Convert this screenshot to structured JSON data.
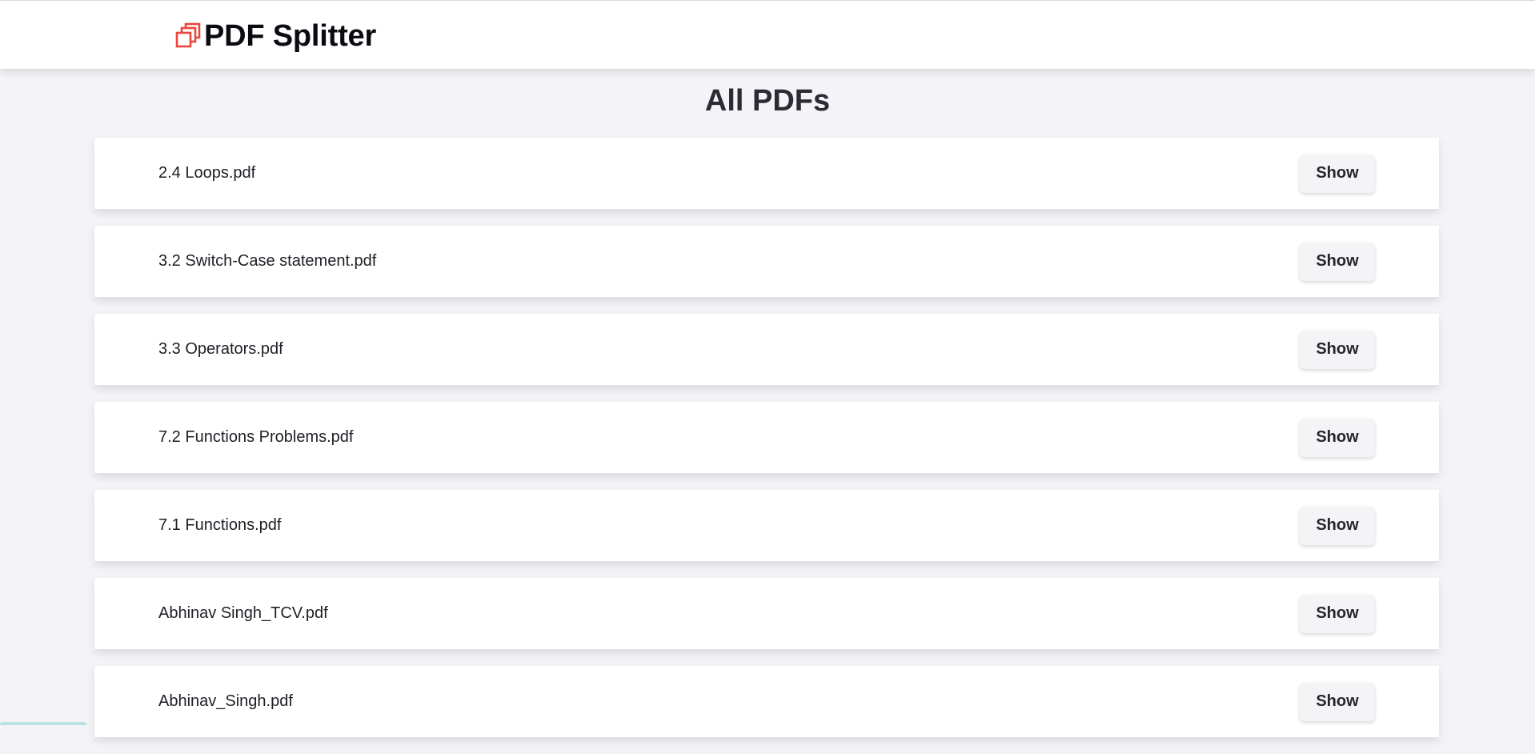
{
  "app": {
    "title": "PDF Splitter",
    "logo_icon": "copy-pages-icon",
    "accent_color": "#e8473e"
  },
  "main": {
    "heading": "All PDFs",
    "files": [
      {
        "name": "2.4 Loops.pdf",
        "action": "Show"
      },
      {
        "name": "3.2 Switch-Case statement.pdf",
        "action": "Show"
      },
      {
        "name": "3.3 Operators.pdf",
        "action": "Show"
      },
      {
        "name": "7.2 Functions Problems.pdf",
        "action": "Show"
      },
      {
        "name": "7.1 Functions.pdf",
        "action": "Show"
      },
      {
        "name": "Abhinav Singh_TCV.pdf",
        "action": "Show"
      },
      {
        "name": "Abhinav_Singh.pdf",
        "action": "Show"
      }
    ]
  }
}
